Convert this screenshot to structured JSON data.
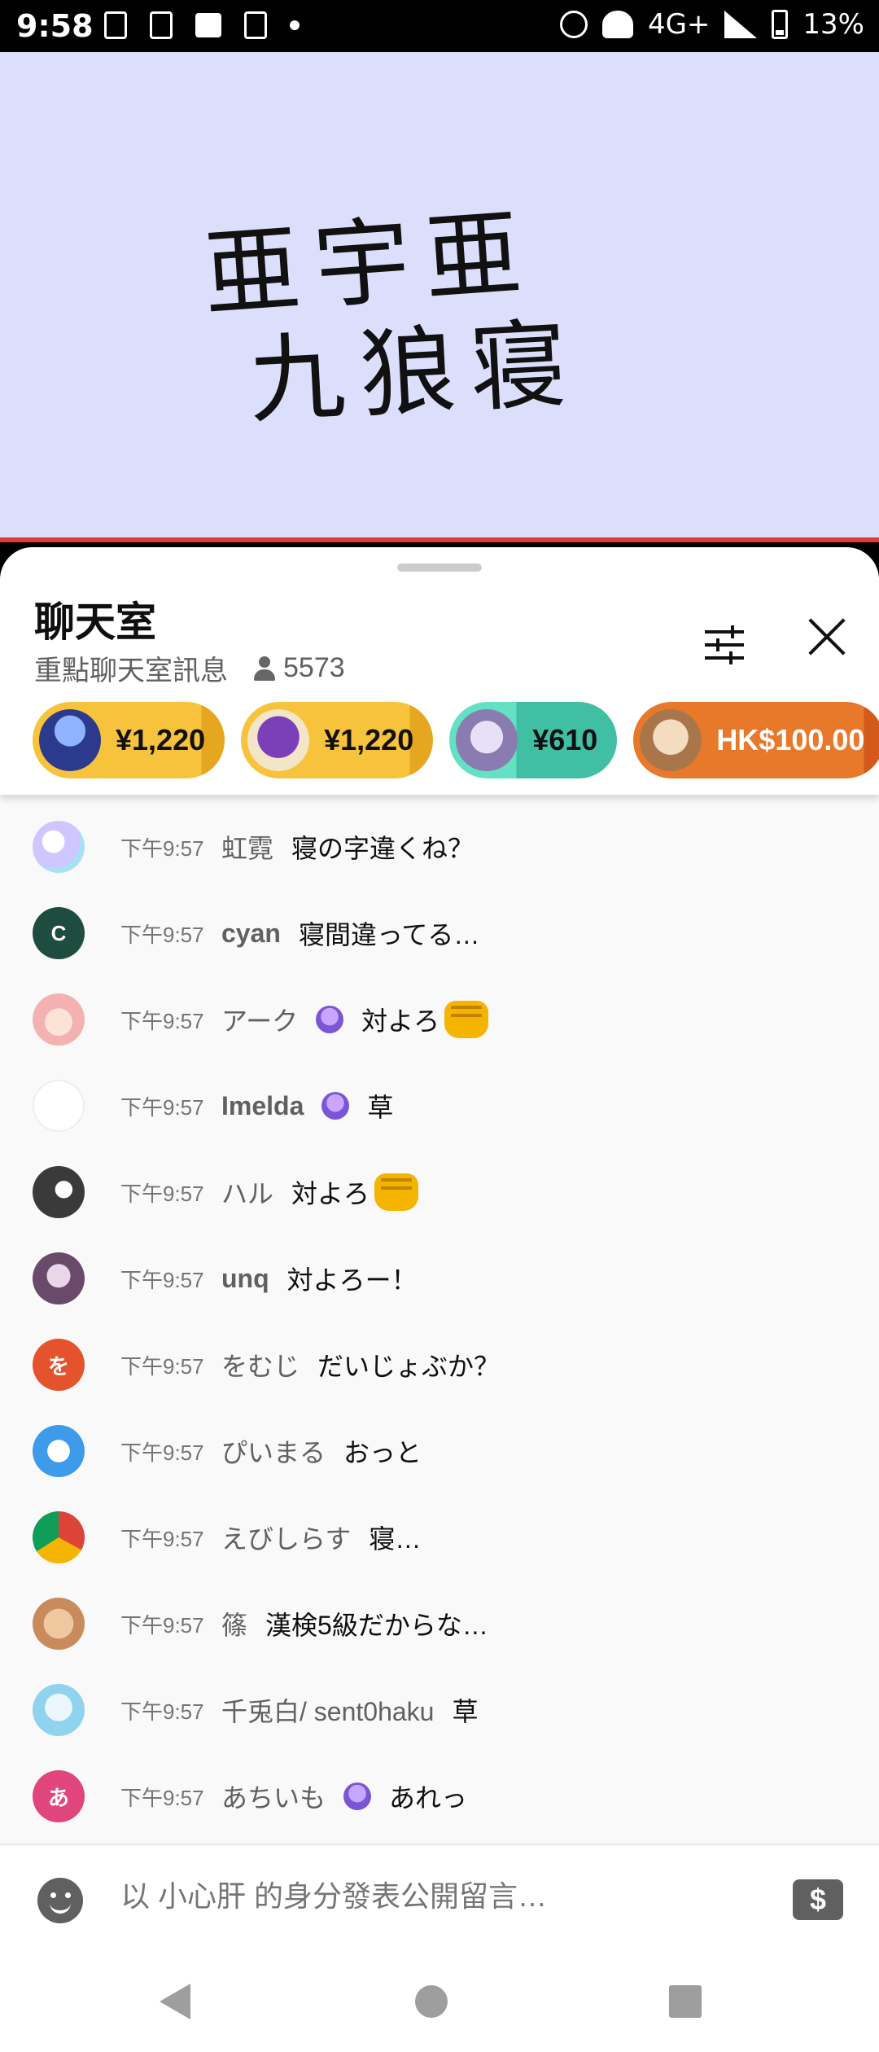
{
  "status_bar": {
    "time": "9:58",
    "network": "4G+",
    "battery": "13%"
  },
  "video": {
    "handwriting_line1": "亜宇亜",
    "handwriting_line2": "九狼寝"
  },
  "chat": {
    "title": "聊天室",
    "subtitle": "重點聊天室訊息",
    "viewer_count": "5573",
    "icons": {
      "filter": "tune-icon",
      "close": "close-icon",
      "viewers": "person-icon"
    }
  },
  "super_chats": [
    {
      "amount": "¥1,220",
      "color": "#f7c23c",
      "avatar_color": "#2b3a8c"
    },
    {
      "amount": "¥1,220",
      "color": "#f7c23c",
      "avatar_color": "#7b3fb8"
    },
    {
      "amount": "¥610",
      "color": "#64e0c2",
      "avatar_color": "#b9a8d6"
    },
    {
      "amount": "HK$100.00",
      "color": "#e8782a",
      "avatar_color": "#a9764b"
    }
  ],
  "messages": [
    {
      "time": "下午9:57",
      "author": "虹霓",
      "text": "寝の字違くね？",
      "avatar_text": "",
      "avatar_color": "#cfc6ff",
      "member_badge": false,
      "emoji": false
    },
    {
      "time": "下午9:57",
      "author": "cyan",
      "text": "寝間違ってる…",
      "avatar_text": "C",
      "avatar_color": "#1e4d3f",
      "member_badge": false,
      "emoji": false
    },
    {
      "time": "下午9:57",
      "author": "アーク",
      "text": "対よろ",
      "avatar_text": "",
      "avatar_color": "#f3b2b0",
      "member_badge": true,
      "emoji": true
    },
    {
      "time": "下午9:57",
      "author": "Imelda",
      "text": "草",
      "avatar_text": "",
      "avatar_color": "#ffffff",
      "member_badge": true,
      "emoji": false
    },
    {
      "time": "下午9:57",
      "author": "ハル",
      "text": "対よろ",
      "avatar_text": "",
      "avatar_color": "#3a3a3a",
      "member_badge": false,
      "emoji": true
    },
    {
      "time": "下午9:57",
      "author": "unq",
      "text": "対よろー！",
      "avatar_text": "",
      "avatar_color": "#6a4a6a",
      "member_badge": false,
      "emoji": false
    },
    {
      "time": "下午9:57",
      "author": "をむじ",
      "text": "だいじょぶか？",
      "avatar_text": "を",
      "avatar_color": "#e5532e",
      "member_badge": false,
      "emoji": false
    },
    {
      "time": "下午9:57",
      "author": "ぴいまる",
      "text": "おっと",
      "avatar_text": "",
      "avatar_color": "#3d9be9",
      "member_badge": false,
      "emoji": false
    },
    {
      "time": "下午9:57",
      "author": "えびしらす",
      "text": "寝…",
      "avatar_text": "",
      "avatar_color": "#db4437",
      "member_badge": false,
      "emoji": false
    },
    {
      "time": "下午9:57",
      "author": "篠",
      "text": "漢検5級だからな…",
      "avatar_text": "",
      "avatar_color": "#c98a5c",
      "member_badge": false,
      "emoji": false
    },
    {
      "time": "下午9:57",
      "author": "千兎白/ sent0haku",
      "text": "草",
      "avatar_text": "",
      "avatar_color": "#8fd3ee",
      "member_badge": false,
      "emoji": false
    },
    {
      "time": "下午9:57",
      "author": "あちいも",
      "text": "あれっ",
      "avatar_text": "あ",
      "avatar_color": "#e0457b",
      "member_badge": true,
      "emoji": false
    }
  ],
  "input": {
    "placeholder": "以 小心肝 的身分發表公開留言…",
    "super_chat_label": "$"
  }
}
